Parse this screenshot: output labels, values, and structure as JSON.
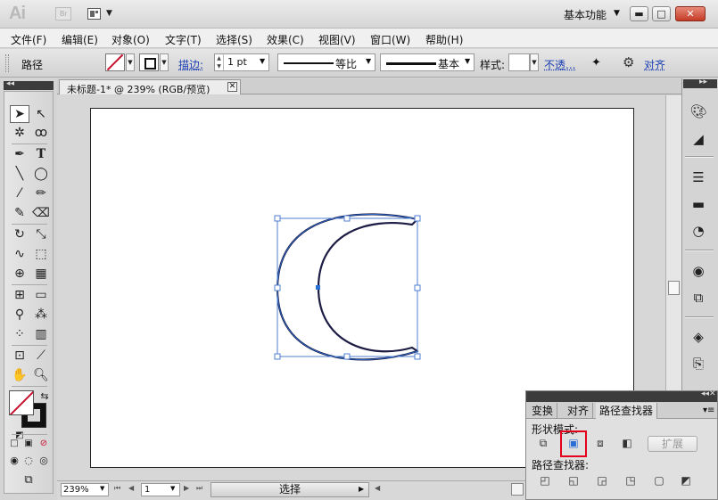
{
  "app": {
    "logo": "Ai",
    "bridge_logo": "Br",
    "workspace": "基本功能",
    "window_buttons": [
      "▬",
      "□",
      "✕"
    ]
  },
  "menu": [
    "文件(F)",
    "编辑(E)",
    "对象(O)",
    "文字(T)",
    "选择(S)",
    "效果(C)",
    "视图(V)",
    "窗口(W)",
    "帮助(H)"
  ],
  "control_bar": {
    "object_type": "路径",
    "stroke_link": "描边:",
    "stroke_weight": "1 pt",
    "stroke_profile": "等比",
    "brush": "基本",
    "style_label": "样式:",
    "opacity_link": "不透...",
    "align_link": "对齐"
  },
  "document": {
    "tab_title": "未标题-1* @ 239% (RGB/预览)",
    "close": "✕"
  },
  "status": {
    "zoom": "239%",
    "page": "1",
    "tool_status": "选择"
  },
  "panel": {
    "tabs": [
      "变换",
      "对齐",
      "路径查找器"
    ],
    "active_tab": "路径查找器",
    "shape_modes_label": "形状模式:",
    "pathfinders_label": "路径查找器:",
    "expand_button": "扩展"
  },
  "colors": {
    "accent_red": "#e4001b",
    "selection_blue": "#2a6fd6",
    "link_blue": "#1b3fb3"
  }
}
